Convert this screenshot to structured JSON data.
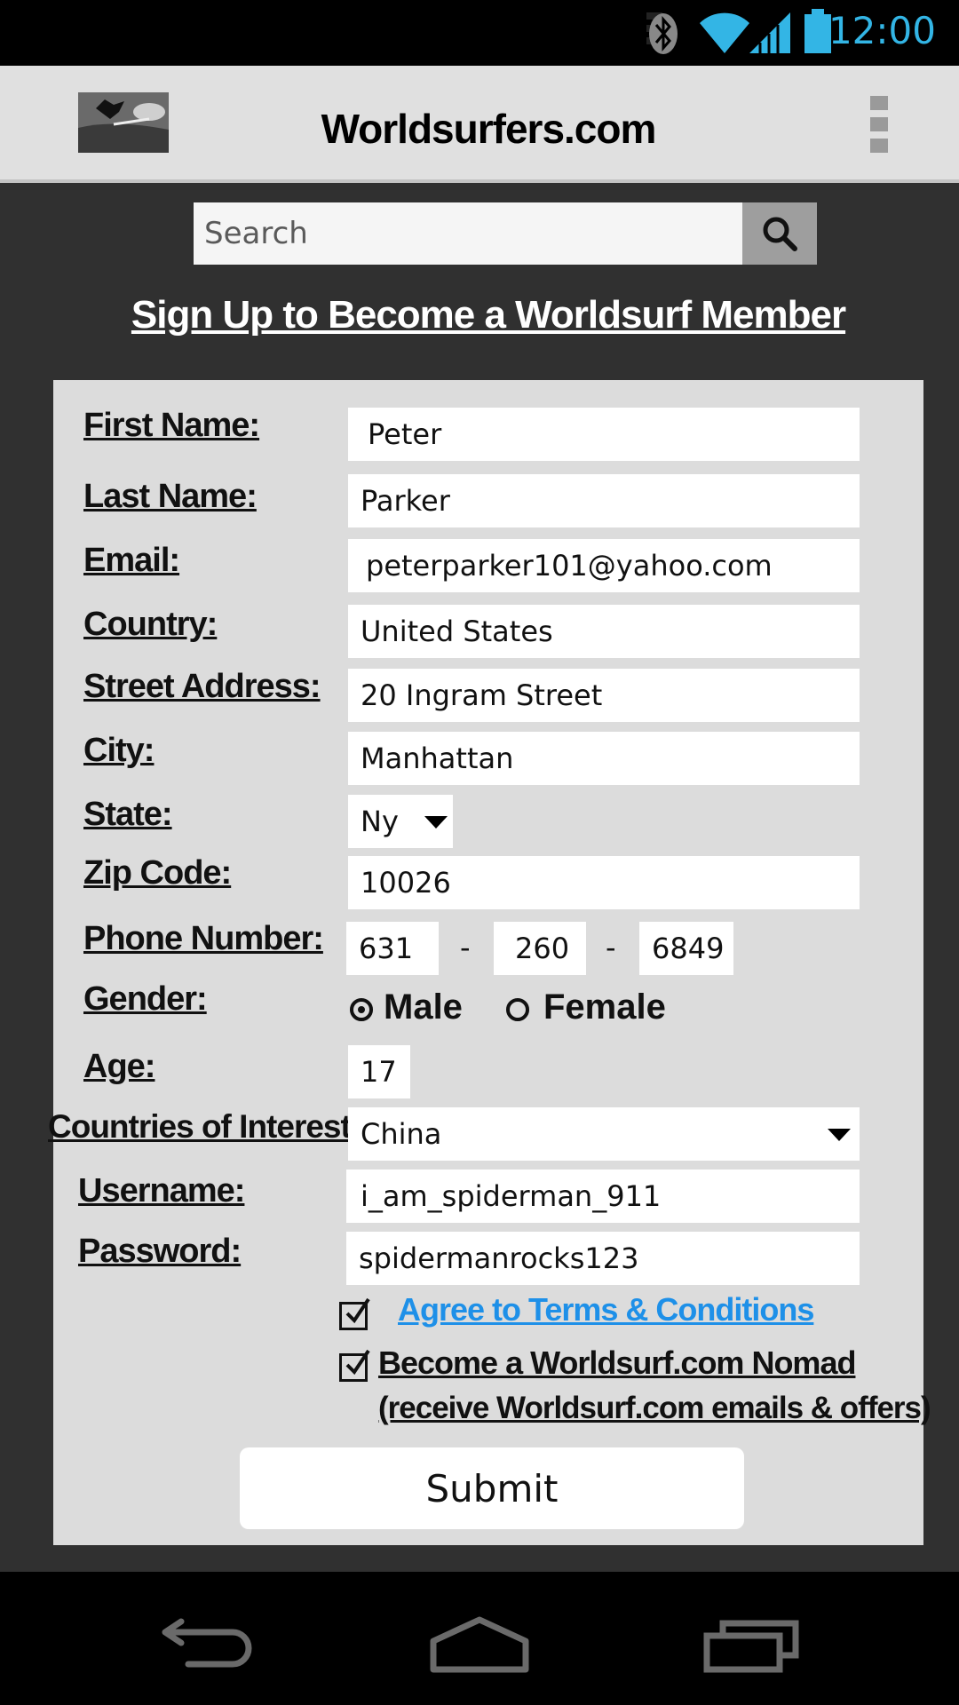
{
  "status_bar": {
    "time": "12:00",
    "icons": [
      "bluetooth-icon",
      "wifi-icon",
      "signal-icon",
      "battery-icon"
    ]
  },
  "app_bar": {
    "title": "Worldsurfers.com",
    "logo": "surfer-photo-logo",
    "menu_icon": "overflow-menu-icon"
  },
  "search": {
    "placeholder": "Search",
    "icon": "search-icon"
  },
  "heading": "Sign Up to Become a Worldsurf Member",
  "form": {
    "first_name": {
      "label": "First Name:",
      "value": "Peter"
    },
    "last_name": {
      "label": "Last Name:",
      "value": "Parker"
    },
    "email": {
      "label": "Email:",
      "value": "peterparker101@yahoo.com"
    },
    "country": {
      "label": "Country:",
      "value": "United States"
    },
    "street_address": {
      "label": "Street Address:",
      "value": "20 Ingram Street"
    },
    "city": {
      "label": "City:",
      "value": "Manhattan"
    },
    "state": {
      "label": "State:",
      "value": "Ny"
    },
    "zip_code": {
      "label": "Zip Code:",
      "value": "10026"
    },
    "phone": {
      "label": "Phone Number:",
      "area": "631",
      "prefix": "260",
      "line": "6849",
      "separator": "-"
    },
    "gender": {
      "label": "Gender:",
      "options": [
        "Male",
        "Female"
      ],
      "selected": "Male"
    },
    "age": {
      "label": "Age:",
      "value": "17"
    },
    "countries_of_interest": {
      "label": "Countries of Interest:",
      "value": "China"
    },
    "username": {
      "label": "Username:",
      "value": "i_am_spiderman_911"
    },
    "password": {
      "label": "Password:",
      "value": "spidermanrocks123"
    },
    "terms": {
      "label": "Agree to Terms & Conditions",
      "checked": true
    },
    "nomad": {
      "label_line1": "Become a Worldsurf.com Nomad ",
      "label_line2": "(receive Worldsurf.com emails & offers)",
      "checked": true
    },
    "submit_label": "Submit"
  },
  "nav_bar": {
    "icons": [
      "back-icon",
      "home-icon",
      "recent-apps-icon"
    ]
  },
  "colors": {
    "accent": "#33b5e5",
    "link": "#1e90e8",
    "panel": "#dcdcdc",
    "background": "#303030"
  }
}
